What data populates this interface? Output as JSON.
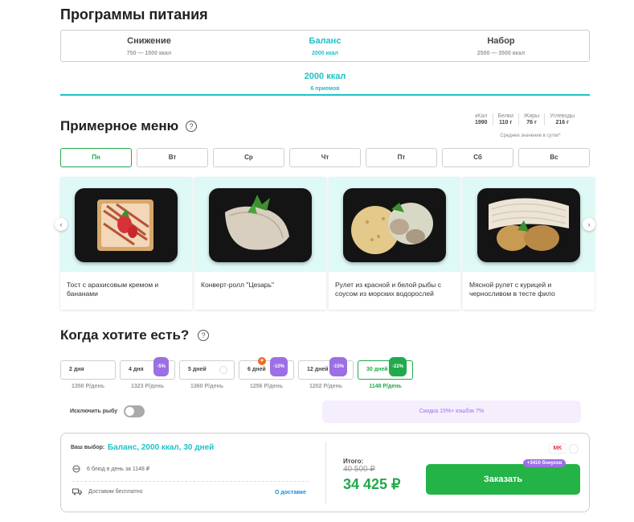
{
  "programs": {
    "title": "Программы питания",
    "items": [
      {
        "name": "Снижение",
        "kcal": "750 — 1500 ккал"
      },
      {
        "name": "Баланс",
        "kcal": "2000 ккал"
      },
      {
        "name": "Набор",
        "kcal": "2500 — 3500 ккал"
      }
    ],
    "selected_kcal": "2000 ккал",
    "meals_count": "6 приемов",
    "accent_color": "#1ec2c9"
  },
  "menu": {
    "title": "Примерное меню",
    "help": "?",
    "nutrition": [
      {
        "label": "кКал",
        "value": "1990"
      },
      {
        "label": "Белки",
        "value": "110 г"
      },
      {
        "label": "Жиры",
        "value": "76 г"
      },
      {
        "label": "Углеводы",
        "value": "216 г"
      }
    ],
    "nutrition_note": "Среднее значение в сутки*",
    "days": [
      "Пн",
      "Вт",
      "Ср",
      "Чт",
      "Пт",
      "Сб",
      "Вс"
    ],
    "cards": [
      {
        "title": "Тост с арахисовым кремом и бананами"
      },
      {
        "title": "Конверт-ролл \"Цезарь\""
      },
      {
        "title": "Рулет из красной и белой рыбы с соусом из морских водорослей"
      },
      {
        "title": "Мясной рулет с курицей и черносливом в тесте фило"
      }
    ],
    "arrow_left": "‹",
    "arrow_right": "›"
  },
  "when": {
    "title": "Когда хотите есть?",
    "help": "?",
    "periods": [
      {
        "label": "2 дня",
        "badge": "",
        "price": "1350 Р/день"
      },
      {
        "label": "4 дня",
        "badge": "-5%",
        "price": "1323 Р/день"
      },
      {
        "label": "5 дней",
        "badge": "",
        "price": "1360 Р/день"
      },
      {
        "label": "6 дней",
        "badge": "-10%",
        "price": "1256 Р/день"
      },
      {
        "label": "12 дней",
        "badge": "-15%",
        "price": "1202 Р/день"
      },
      {
        "label": "30 дней",
        "badge": "-22%",
        "price": "1148 Р/день"
      }
    ],
    "fire_icon": "✦",
    "exclude_fish_label": "Исключить рыбу",
    "promo_text": "Скидка 15%+ кэшбэк 7%"
  },
  "summary": {
    "choice_label": "Ваш выбор:",
    "choice_value": "Баланс, 2000 ккал, 30 дней",
    "meals_text": "6 блюд в день за 1148 ₽",
    "delivery_text": "Доставим бесплатно",
    "delivery_link": "О доставке",
    "total_label": "Итого:",
    "old_price": "40 500 ₽",
    "new_price": "34 425 ₽",
    "order_button": "Заказать",
    "bonus_badge": "+3410 бонусов",
    "mk_logo": "MK"
  }
}
